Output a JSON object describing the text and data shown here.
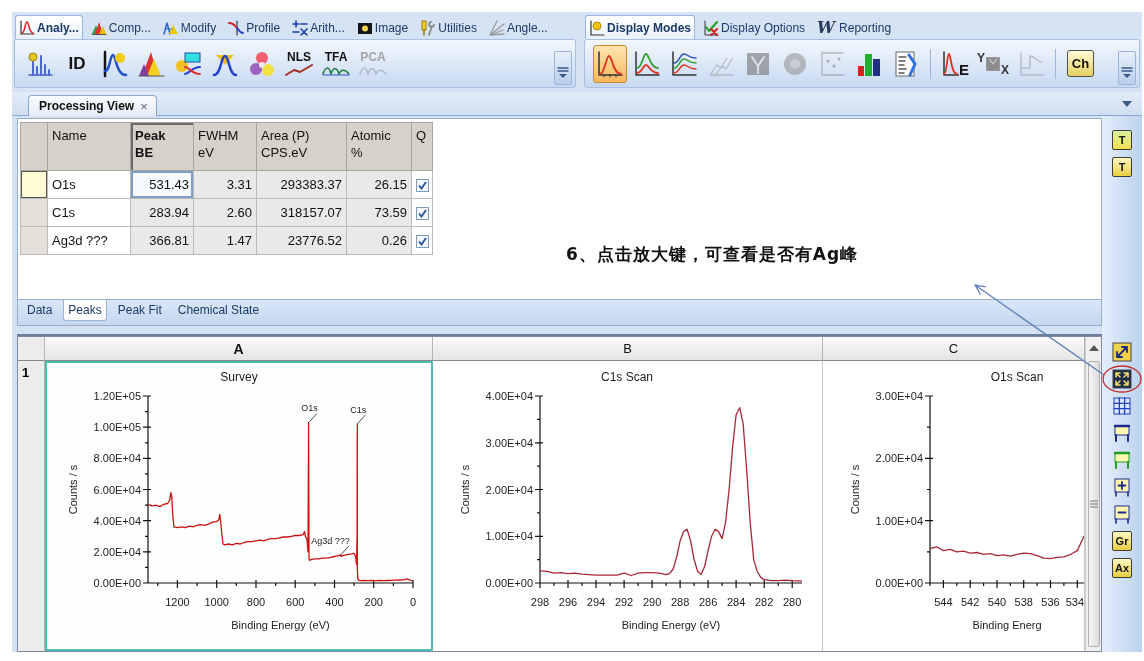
{
  "ribbon": {
    "tab_groups": [
      {
        "tabs": [
          {
            "label": "Analy...",
            "selected": true
          },
          {
            "label": "Comp...",
            "selected": false
          },
          {
            "label": "Modify",
            "selected": false
          },
          {
            "label": "Profile",
            "selected": false
          },
          {
            "label": "Arith...",
            "selected": false
          },
          {
            "label": "Image",
            "selected": false
          },
          {
            "label": "Utilities",
            "selected": false
          },
          {
            "label": "Angle...",
            "selected": false
          }
        ]
      },
      {
        "tabs": [
          {
            "label": "Display Modes",
            "selected": true
          },
          {
            "label": "Display Options",
            "selected": false
          },
          {
            "glyph": "W",
            "label": "Reporting",
            "selected": false
          }
        ]
      }
    ],
    "toolbars": [
      {
        "buttons": [
          {
            "disabled": false
          },
          {
            "glyphs": [
              "ID"
            ],
            "disabled": false
          },
          {
            "disabled": false
          },
          {
            "disabled": false
          },
          {
            "disabled": false
          },
          {
            "disabled": false
          },
          {
            "disabled": false
          },
          {
            "glyphs": [
              "NLS"
            ],
            "disabled": false
          },
          {
            "glyphs": [
              "TFA"
            ],
            "disabled": false
          },
          {
            "glyphs": [
              "PCA"
            ],
            "disabled": true
          }
        ]
      },
      {
        "buttons": [
          {
            "selected": true,
            "disabled": false
          },
          {
            "selected": false,
            "disabled": false
          },
          {
            "selected": false,
            "disabled": false
          },
          {
            "selected": false,
            "disabled": true
          },
          {
            "selected": false,
            "disabled": true
          },
          {
            "selected": false,
            "disabled": true
          },
          {
            "selected": false,
            "disabled": true
          },
          {
            "selected": false,
            "disabled": false
          },
          {
            "selected": false,
            "disabled": false
          },
          {
            "glyphs": [
              "E"
            ],
            "selected": false,
            "disabled": false
          },
          {
            "glyphs": [
              "Y",
              "X"
            ],
            "selected": false,
            "disabled": false
          },
          {
            "selected": false,
            "disabled": true
          },
          {
            "glyphs": [
              "Ch"
            ],
            "selected": false,
            "disabled": false
          }
        ]
      }
    ]
  },
  "document_tab": {
    "title": "Processing View",
    "close": "×"
  },
  "table": {
    "columns": [
      {
        "lines": [
          "Name"
        ],
        "kind": "name",
        "selected": false
      },
      {
        "lines": [
          "Peak",
          "BE"
        ],
        "kind": "value",
        "selected": true
      },
      {
        "lines": [
          "FWHM",
          "eV"
        ],
        "kind": "value",
        "selected": false
      },
      {
        "lines": [
          "Area (P)",
          "CPS.eV"
        ],
        "kind": "value",
        "selected": false
      },
      {
        "lines": [
          "Atomic",
          "%"
        ],
        "kind": "value",
        "selected": false
      },
      {
        "lines": [
          "Q"
        ],
        "kind": "check",
        "selected": false
      }
    ],
    "rows": [
      {
        "cells": [
          "O1s",
          "531.43",
          "3.31",
          "293383.37",
          "26.15"
        ],
        "checked": true,
        "selected": true
      },
      {
        "cells": [
          "C1s",
          "283.94",
          "2.60",
          "318157.07",
          "73.59"
        ],
        "checked": true,
        "selected": false
      },
      {
        "cells": [
          "Ag3d ???",
          "366.81",
          "1.47",
          "23776.52",
          "0.26"
        ],
        "checked": true,
        "selected": false
      }
    ]
  },
  "annotation": {
    "text": "6、点击放大键，可查看是否有Ag峰"
  },
  "panel_tabs": [
    {
      "label": "Data",
      "selected": false
    },
    {
      "label": "Peaks",
      "selected": true
    },
    {
      "label": "Peak Fit",
      "selected": false
    },
    {
      "label": "Chemical State",
      "selected": false
    }
  ],
  "chart_grid": {
    "columns": [
      "A",
      "B",
      "C"
    ],
    "rows": [
      {
        "label": "1",
        "cells": [
          {
            "selected": true,
            "chart_data": {
              "type": "line",
              "title": "Survey",
              "xlabel": "Binding Energy (eV)",
              "ylabel": "Counts / s",
              "x": [
                1350,
                1330,
                1310,
                1290,
                1270,
                1250,
                1240,
                1233,
                1229,
                1224,
                1218,
                1200,
                1180,
                1160,
                1140,
                1120,
                1100,
                1080,
                1060,
                1040,
                1020,
                1000,
                990,
                984,
                980,
                975,
                968,
                960,
                940,
                920,
                900,
                880,
                860,
                840,
                820,
                800,
                780,
                760,
                740,
                720,
                700,
                680,
                660,
                640,
                620,
                600,
                580,
                560,
                552,
                548,
                540,
                535,
                532,
                530,
                527,
                520,
                500,
                480,
                460,
                440,
                420,
                400,
                380,
                370,
                366,
                360,
                340,
                320,
                300,
                292,
                288,
                285,
                284,
                283,
                281,
                278,
                270,
                250,
                230,
                210,
                190,
                170,
                150,
                130,
                110,
                90,
                70,
                50,
                30,
                20,
                10,
                0
              ],
              "series": [
                {
                  "color": "#cc1111",
                  "values": [
                    50500,
                    49500,
                    50000,
                    49000,
                    50500,
                    51000,
                    53000,
                    58000,
                    55000,
                    44000,
                    36000,
                    35500,
                    36000,
                    35500,
                    36500,
                    36000,
                    37000,
                    37500,
                    37000,
                    38000,
                    39000,
                    39500,
                    40500,
                    44000,
                    40000,
                    33000,
                    25000,
                    24500,
                    25000,
                    24500,
                    25500,
                    25000,
                    26000,
                    26500,
                    26500,
                    27000,
                    27500,
                    27000,
                    28000,
                    28500,
                    28500,
                    29000,
                    29500,
                    29500,
                    30000,
                    30500,
                    30500,
                    31000,
                    33000,
                    30000,
                    28000,
                    20000,
                    103000,
                    16000,
                    14500,
                    15000,
                    15500,
                    15500,
                    16000,
                    16000,
                    16500,
                    17000,
                    17500,
                    18000,
                    17000,
                    17500,
                    18000,
                    18500,
                    19000,
                    17000,
                    12000,
                    30000,
                    102000,
                    8000,
                    3000,
                    1800,
                    1500,
                    1600,
                    1500,
                    1600,
                    1500,
                    1600,
                    1500,
                    1600,
                    1700,
                    1800,
                    1900,
                    2000,
                    2600,
                    2200,
                    1600,
                    1200
                  ]
                }
              ],
              "xlim": [
                1350,
                0
              ],
              "ylim": [
                0,
                120000
              ],
              "xticks": [
                1200,
                1000,
                800,
                600,
                400,
                200,
                0
              ],
              "yticks": [
                {
                  "value": 0,
                  "label": "0.00E+00"
                },
                {
                  "value": 20000,
                  "label": "2.00E+04"
                },
                {
                  "value": 40000,
                  "label": "4.00E+04"
                },
                {
                  "value": 60000,
                  "label": "6.00E+04"
                },
                {
                  "value": 80000,
                  "label": "8.00E+04"
                },
                {
                  "value": 100000,
                  "label": "1.00E+05"
                },
                {
                  "value": 120000,
                  "label": "1.20E+05"
                }
              ],
              "annotations": [
                {
                  "text": "O1s",
                  "x": 531,
                  "y": 103000
                },
                {
                  "text": "C1s",
                  "x": 284,
                  "y": 102000
                },
                {
                  "text": "Ag3d ???",
                  "x": 368,
                  "y": 18000
                }
              ]
            }
          },
          {
            "selected": false,
            "chart_data": {
              "type": "line",
              "title": "C1s Scan",
              "xlabel": "Binding Energy (eV)",
              "ylabel": "Counts / s",
              "x": [
                298,
                297.5,
                297,
                296.5,
                296,
                295.5,
                295,
                294.5,
                294,
                293.5,
                293,
                292.5,
                292,
                291.5,
                291,
                290.5,
                290,
                289.5,
                289,
                288.75,
                288.5,
                288.25,
                288,
                287.75,
                287.5,
                287.25,
                287,
                286.75,
                286.5,
                286.25,
                286,
                285.75,
                285.5,
                285.25,
                285,
                284.75,
                284.5,
                284.25,
                284,
                283.75,
                283.5,
                283.25,
                283,
                282.75,
                282.5,
                282.25,
                282,
                281.5,
                281,
                280.5,
                280,
                279.3
              ],
              "series": [
                {
                  "color": "#a8283a",
                  "values": [
                    2600,
                    2500,
                    2100,
                    2200,
                    2000,
                    2100,
                    1900,
                    1800,
                    1700,
                    1700,
                    1700,
                    1700,
                    2100,
                    1600,
                    2100,
                    2200,
                    2200,
                    2100,
                    1800,
                    2000,
                    3000,
                    5500,
                    9000,
                    11000,
                    11500,
                    9000,
                    5000,
                    2500,
                    1800,
                    3500,
                    7000,
                    10000,
                    11500,
                    11000,
                    9500,
                    13000,
                    20000,
                    29000,
                    36000,
                    37500,
                    34000,
                    24000,
                    13000,
                    5000,
                    2500,
                    1200,
                    700,
                    500,
                    500,
                    600,
                    500,
                    400
                  ]
                }
              ],
              "xlim": [
                298,
                279.3
              ],
              "ylim": [
                0,
                40000
              ],
              "xticks": [
                298,
                296,
                294,
                292,
                290,
                288,
                286,
                284,
                282,
                280
              ],
              "yticks": [
                {
                  "value": 0,
                  "label": "0.00E+00"
                },
                {
                  "value": 10000,
                  "label": "1.00E+04"
                },
                {
                  "value": 20000,
                  "label": "2.00E+04"
                },
                {
                  "value": 30000,
                  "label": "3.00E+04"
                },
                {
                  "value": 40000,
                  "label": "4.00E+04"
                }
              ]
            }
          },
          {
            "selected": false,
            "chart_data": {
              "type": "line",
              "title": "O1s Scan",
              "xlabel": "Binding Energ",
              "ylabel": "Counts / s",
              "x": [
                545,
                544.5,
                544,
                543.5,
                543,
                542.5,
                542,
                541.5,
                541,
                540.5,
                540,
                539.5,
                539,
                538.5,
                538,
                537.5,
                537,
                536.5,
                536,
                535.5,
                535,
                534.5,
                534,
                533.5
              ],
              "series": [
                {
                  "color": "#a8283a",
                  "values": [
                    5500,
                    5800,
                    5200,
                    5400,
                    5000,
                    5100,
                    4800,
                    4900,
                    4600,
                    4700,
                    4400,
                    4500,
                    4300,
                    4600,
                    4800,
                    4700,
                    4400,
                    4000,
                    3900,
                    4100,
                    4200,
                    4600,
                    5200,
                    7500
                  ]
                }
              ],
              "xlim": [
                545,
                533.5
              ],
              "ylim": [
                0,
                30000
              ],
              "xticks": [
                544,
                542,
                540,
                538,
                536,
                534
              ],
              "yticks": [
                {
                  "value": 0,
                  "label": "0.00E+00"
                },
                {
                  "value": 10000,
                  "label": "1.00E+04"
                },
                {
                  "value": 20000,
                  "label": "2.00E+04"
                },
                {
                  "value": 30000,
                  "label": "3.00E+04"
                }
              ]
            }
          }
        ]
      }
    ]
  },
  "side_toolbar": {
    "top": [
      {
        "glyphs": [
          "T"
        ]
      },
      {
        "glyphs": [
          "T"
        ]
      }
    ],
    "bottom": [
      {
        "circled": false
      },
      {
        "circled": true
      },
      {
        "circled": false
      },
      {
        "circled": false
      },
      {
        "circled": false
      },
      {
        "circled": false
      },
      {
        "circled": false
      },
      {
        "glyphs": [
          "Gr"
        ],
        "circled": false
      },
      {
        "glyphs": [
          "Ax"
        ],
        "circled": false
      }
    ]
  }
}
